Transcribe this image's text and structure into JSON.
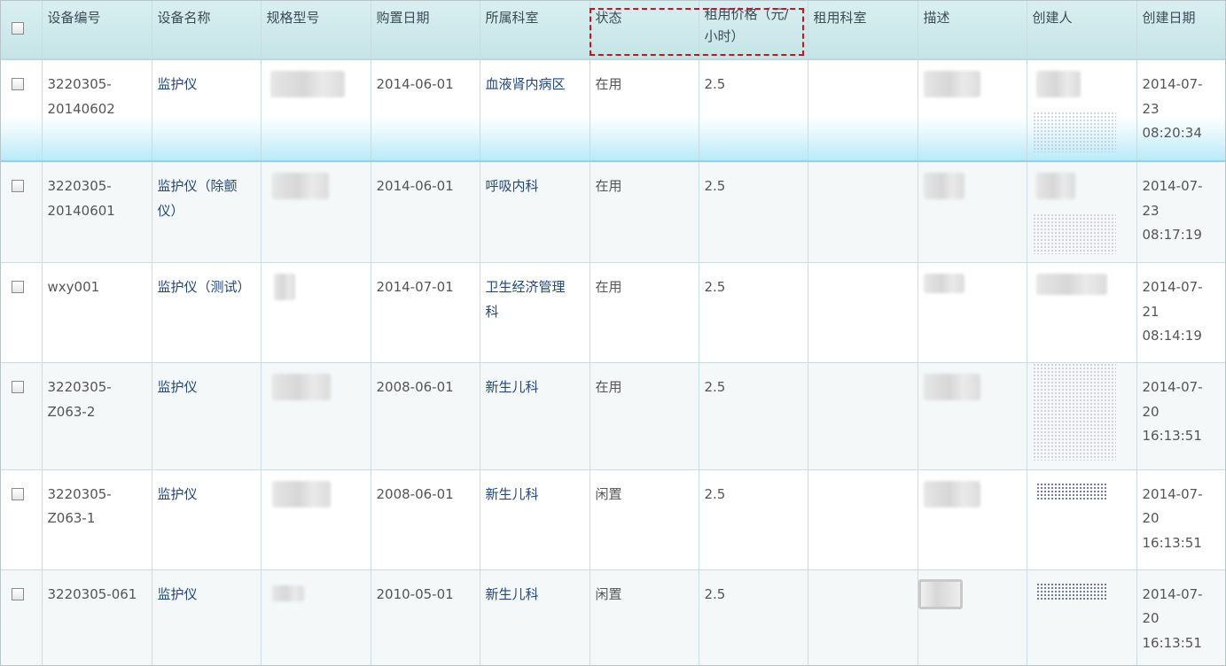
{
  "table": {
    "headers": [
      "设备编号",
      "设备名称",
      "规格型号",
      "购置日期",
      "所属科室",
      "状态",
      "租用价格（元/小时）",
      "租用科室",
      "描述",
      "创建人",
      "创建日期"
    ],
    "rows": [
      {
        "id_line1": "3220305-",
        "id_line2": "20140602",
        "name_line1": "监护仪",
        "name_line2": "",
        "date": "2014-06-01",
        "dept_line1": "血液肾内病区",
        "dept_line2": "",
        "status": "在用",
        "price": "2.5",
        "created_d1": "2014-07-",
        "created_d2": "23",
        "created_t": "08:20:34"
      },
      {
        "id_line1": "3220305-",
        "id_line2": "20140601",
        "name_line1": "监护仪（除颤",
        "name_line2": "仪）",
        "date": "2014-06-01",
        "dept_line1": "呼吸内科",
        "dept_line2": "",
        "status": "在用",
        "price": "2.5",
        "created_d1": "2014-07-",
        "created_d2": "23",
        "created_t": "08:17:19"
      },
      {
        "id_line1": "wxy001",
        "id_line2": "",
        "name_line1": "监护仪（测试）",
        "name_line2": "",
        "date": "2014-07-01",
        "dept_line1": "卫生经济管理",
        "dept_line2": "科",
        "status": "在用",
        "price": "2.5",
        "created_d1": "2014-07-",
        "created_d2": "21",
        "created_t": "08:14:19"
      },
      {
        "id_line1": "3220305-",
        "id_line2": "Z063-2",
        "name_line1": "监护仪",
        "name_line2": "",
        "date": "2008-06-01",
        "dept_line1": "新生儿科",
        "dept_line2": "",
        "status": "在用",
        "price": "2.5",
        "created_d1": "2014-07-",
        "created_d2": "20",
        "created_t": "16:13:51"
      },
      {
        "id_line1": "3220305-",
        "id_line2": "Z063-1",
        "name_line1": "监护仪",
        "name_line2": "",
        "date": "2008-06-01",
        "dept_line1": "新生儿科",
        "dept_line2": "",
        "status": "闲置",
        "price": "2.5",
        "created_d1": "2014-07-",
        "created_d2": "20",
        "created_t": "16:13:51"
      },
      {
        "id_line1": "3220305-061",
        "id_line2": "",
        "name_line1": "监护仪",
        "name_line2": "",
        "date": "2010-05-01",
        "dept_line1": "新生儿科",
        "dept_line2": "",
        "status": "闲置",
        "price": "2.5",
        "created_d1": "2014-07-",
        "created_d2": "20",
        "created_t": "16:13:51"
      }
    ]
  },
  "colors": {
    "header_bg": "#c5e4e7",
    "link": "#24487e",
    "highlight_border": "#c4161c",
    "selected_row_glow": "#b9eaf8"
  }
}
